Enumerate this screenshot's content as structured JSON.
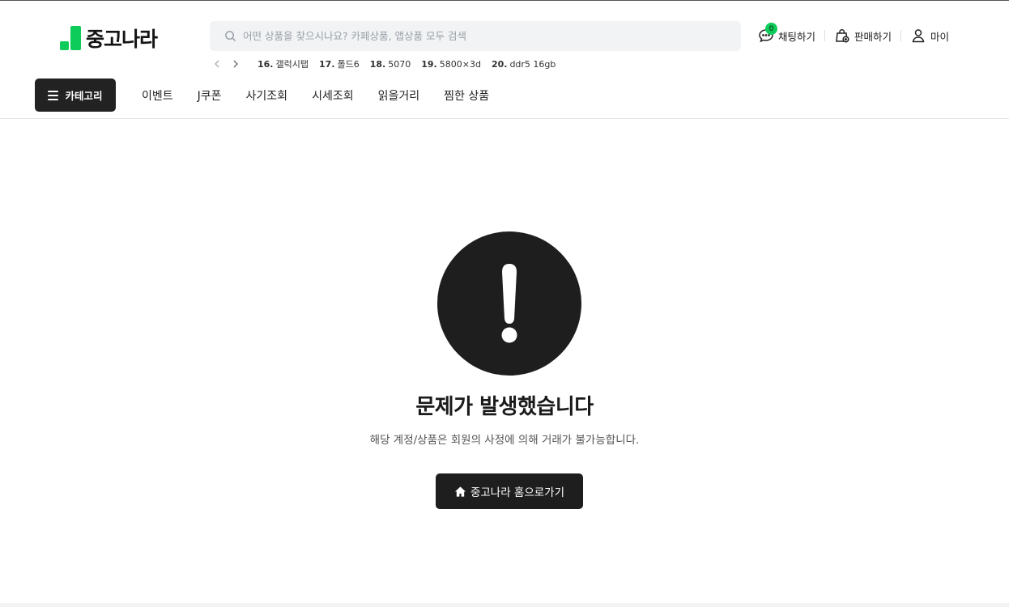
{
  "brand": {
    "name": "중고나라",
    "accent": "#0dcc5a"
  },
  "search": {
    "placeholder": "어떤 상품을 찾으시나요? 카페상품, 앱상품 모두 검색",
    "value": ""
  },
  "rankings": [
    {
      "rank": "16.",
      "keyword": "갤럭시탭"
    },
    {
      "rank": "17.",
      "keyword": "폴드6"
    },
    {
      "rank": "18.",
      "keyword": "5070"
    },
    {
      "rank": "19.",
      "keyword": "5800×3d"
    },
    {
      "rank": "20.",
      "keyword": "ddr5 16gb"
    }
  ],
  "user_actions": {
    "chat": {
      "label": "채팅하기",
      "badge": "0"
    },
    "sell": {
      "label": "판매하기"
    },
    "my": {
      "label": "마이"
    }
  },
  "nav": {
    "category_label": "카테고리",
    "links": [
      "이벤트",
      "J쿠폰",
      "사기조회",
      "시세조회",
      "읽을거리",
      "찜한 상품"
    ]
  },
  "error": {
    "title": "문제가 발생했습니다",
    "description": "해당 계정/상품은 회원의 사정에 의해 거래가 불가능합니다.",
    "home_button": "중고나라 홈으로가기"
  }
}
